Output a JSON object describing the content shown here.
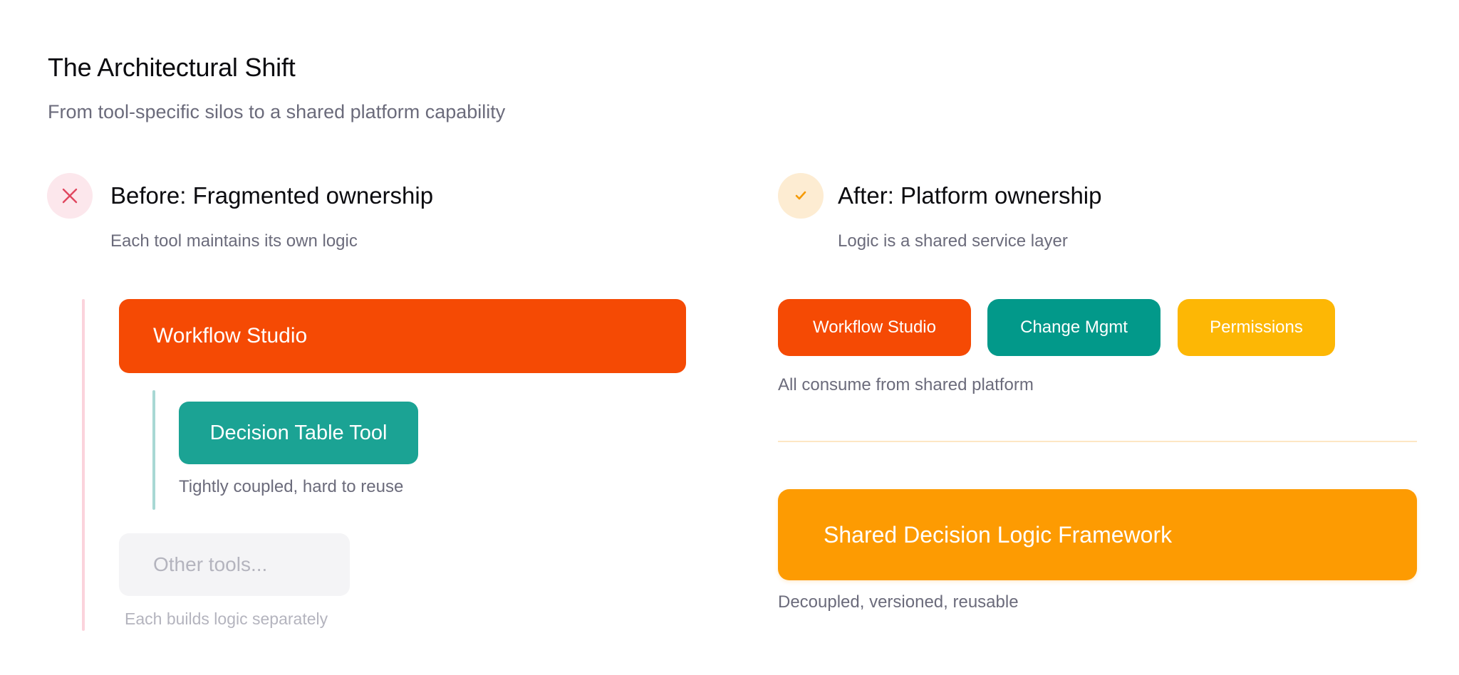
{
  "header": {
    "title": "The Architectural Shift",
    "subtitle": "From tool-specific silos to a shared platform capability"
  },
  "before": {
    "icon": "x-icon",
    "heading": "Before: Fragmented ownership",
    "subheading": "Each tool maintains its own logic",
    "workflow_label": "Workflow Studio",
    "decision_tool_label": "Decision Table Tool",
    "coupled_note": "Tightly coupled, hard to reuse",
    "other_tools_label": "Other tools...",
    "separate_note": "Each builds logic separately"
  },
  "after": {
    "icon": "check-icon",
    "heading": "After: Platform ownership",
    "subheading": "Logic is a shared service layer",
    "chips": [
      {
        "label": "Workflow Studio",
        "color": "#f54a04"
      },
      {
        "label": "Change Mgmt",
        "color": "#02998a"
      },
      {
        "label": "Permissions",
        "color": "#fdb705"
      }
    ],
    "consume_note": "All consume from shared platform",
    "framework_label": "Shared Decision Logic Framework",
    "decoupled_note": "Decoupled, versioned, reusable"
  },
  "colors": {
    "orange_red": "#f54a04",
    "teal": "#1ba394",
    "amber": "#fd9b02",
    "yellow": "#fdb705",
    "muted_text": "#6b6b7b"
  }
}
